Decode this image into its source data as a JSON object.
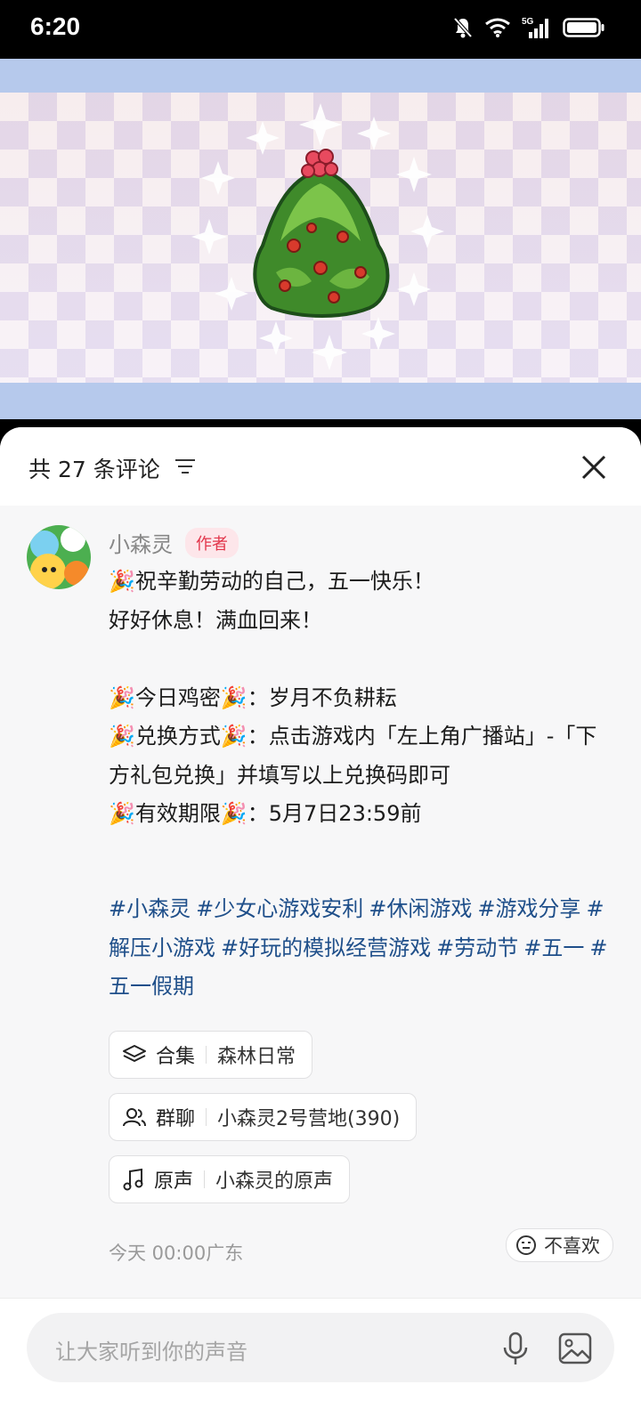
{
  "status_bar": {
    "time": "6:20",
    "network": "5G"
  },
  "comments": {
    "title": "共 27 条评论",
    "close_label": "关闭",
    "author": {
      "name": "小森灵",
      "badge": "作者"
    },
    "body": "🎉祝辛勤劳动的自己，五一快乐！\n好好休息！满血回来！\n\n🎉今日鸡密🎉：岁月不负耕耘\n🎉兑换方式🎉：点击游戏内「左上角广播站」-「下方礼包兑换」并填写以上兑换码即可\n🎉有效期限🎉：5月7日23:59前",
    "hashtags": [
      "#小森灵",
      "#少女心游戏安利",
      "#休闲游戏",
      "#游戏分享",
      "#解压小游戏",
      "#好玩的模拟经营游戏",
      "#劳动节",
      "#五一",
      "#五一假期"
    ],
    "chips": [
      {
        "icon": "layers-icon",
        "label": "合集",
        "value": "森林日常"
      },
      {
        "icon": "group-icon",
        "label": "群聊",
        "value": "小森灵2号营地(390)"
      },
      {
        "icon": "music-note-icon",
        "label": "原声",
        "value": "小森灵的原声"
      }
    ],
    "meta": "今天 00:00广东",
    "dislike_label": "不喜欢"
  },
  "input": {
    "placeholder": "让大家听到你的声音"
  },
  "colors": {
    "hashtag": "#1f4f8a",
    "badge_text": "#e2364b",
    "badge_bg": "#fde6ea"
  }
}
